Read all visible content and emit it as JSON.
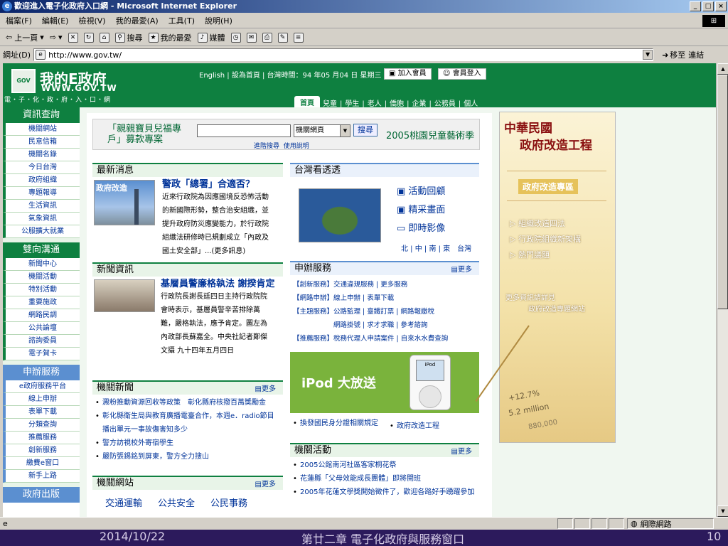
{
  "window": {
    "title": "歡迎進入電子化政府入口網 - Microsoft Internet Explorer",
    "menu": [
      "檔案(F)",
      "編輯(E)",
      "檢視(V)",
      "我的最愛(A)",
      "工具(T)",
      "說明(H)"
    ],
    "toolbar": {
      "back": "上一頁",
      "search": "搜尋",
      "favorites": "我的最愛",
      "media": "媒體"
    },
    "address_label": "網址(D)",
    "address": "http://www.gov.tw/",
    "go": "移至",
    "links": "連結",
    "status_zone": "網際網路"
  },
  "site": {
    "logo_name": "我的E政府",
    "logo_url": "WWW.GOV.TW",
    "logo_tag": "電・子・化・政・府・入・口・網",
    "gov_badge": "GOV",
    "topline": "English | 設為首頁 | 台灣時間：94 年05 月04 日 星期三",
    "join": "加入會員",
    "login": "會員登入",
    "tabs": [
      "首頁",
      "兒童",
      "學生",
      "老人",
      "僑胞",
      "企業",
      "公務員",
      "個人"
    ]
  },
  "nav": {
    "info_title": "資訊查詢",
    "info_items": [
      "機關網站",
      "民意信箱",
      "機關名錄",
      "今日台灣",
      "政府組織",
      "專題報導",
      "生活資訊",
      "氣象資訊",
      "公服擴大就業"
    ],
    "comm_title": "雙向溝通",
    "comm_items": [
      "新聞中心",
      "機關活動",
      "特別活動",
      "重要施政",
      "網路民調",
      "公共論壇",
      "諮詢委員",
      "電子賀卡"
    ],
    "service_title": "申辦服務",
    "service_items": [
      "e政府服務平台",
      "線上申辦",
      "表單下載",
      "分類查詢",
      "推薦服務",
      "創新服務",
      "繳費e窗口",
      "新手上路"
    ],
    "more_title": "政府出版"
  },
  "search": {
    "promo_left": "「親親寶貝兒福專戶」募款專案",
    "select": "機關網頁",
    "button": "搜尋",
    "advanced": "進階搜尋",
    "help": "使用說明",
    "promo_right": "2005桃園兒童藝術季"
  },
  "latest": {
    "title": "最新消息",
    "photo_label": "政府改造",
    "headline": "警政「總署」合適否？",
    "body": [
      "近來行政院為因應國境反恐怖活動",
      "的新國際形勢，整合治安組織，並",
      "提升政府防災應變能力，於行政院",
      "組織法研修時已規劃成立「內政及",
      "國土安全部」...(更多訊息)"
    ]
  },
  "taiwan": {
    "title": "台灣看透透",
    "links": [
      "活動回顧",
      "精采畫面",
      "即時影像"
    ],
    "regions": "北 | 中 | 南 | 東　台灣"
  },
  "news": {
    "title": "新聞資訊",
    "headline": "基層員警廉格執法 謝揆肯定",
    "body": [
      "行政院長謝長廷四日主持行政院院",
      "會時表示，基層員警辛苦排除萬",
      "難，嚴格執法，應予肯定。圖左為",
      "內政部長蘇嘉全。中央社記者鄭傑",
      "文攝 九十四年五月四日"
    ]
  },
  "services": {
    "title": "申辦服務",
    "more": "更多",
    "rows": [
      "【創新服務】交通違規服務 | 更多服務",
      "【網路申辦】線上申辦 | 表單下載",
      "【主題服務】公路監理 | 臺鐵訂票 | 網路報繳稅",
      "　　　　　　網路掛號 | 求才求職 | 參考諮詢",
      "【推薦服務】稅務代理人申請案件 | 自來水水費查詢"
    ]
  },
  "agency_news": {
    "title": "機關新聞",
    "more": "更多",
    "items": [
      "澱粉推動資源回收等政策　彰化縣府核撥百萬獎勵金",
      "彰化縣衛生局與教育廣播電臺合作，本週e．radio節目播出單元一事故傷害知多少",
      "警方訪視校外寄宿學生",
      "嚴防張錫銘到屏東，警方全力搜山"
    ]
  },
  "ipod": {
    "title": "iPod 大放送",
    "screen_label": "iPod"
  },
  "mid_links": [
    "換發國民身分證相關規定",
    "政府改造工程"
  ],
  "activities": {
    "title": "機關活動",
    "more": "更多",
    "items": [
      "2005公館南河社區客家桐花祭",
      "花蓮縣「父母效能成長團體」即將開班",
      "2005年花蓮文學獎開始徵件了，歡迎各路好手踴躍參加"
    ]
  },
  "agency_sites": {
    "title": "機關網站",
    "more": "更多",
    "items": [
      "交通運輸",
      "公共安全",
      "公民事務"
    ]
  },
  "ad": {
    "title1": "中華民國",
    "title2": "政府改造工程",
    "zone": "政府改造專區",
    "links": [
      "組織改造四法",
      "行政院組織新架構",
      "熱門議題"
    ],
    "more1": "更多資訊請詳見",
    "more2": "政府改造專題網站",
    "stats": [
      "+12.7%",
      "5.2 million",
      "880,000"
    ]
  },
  "slide": {
    "date": "2014/10/22",
    "chapter": "第廿二章 電子化政府與服務窗口",
    "page": "10"
  }
}
